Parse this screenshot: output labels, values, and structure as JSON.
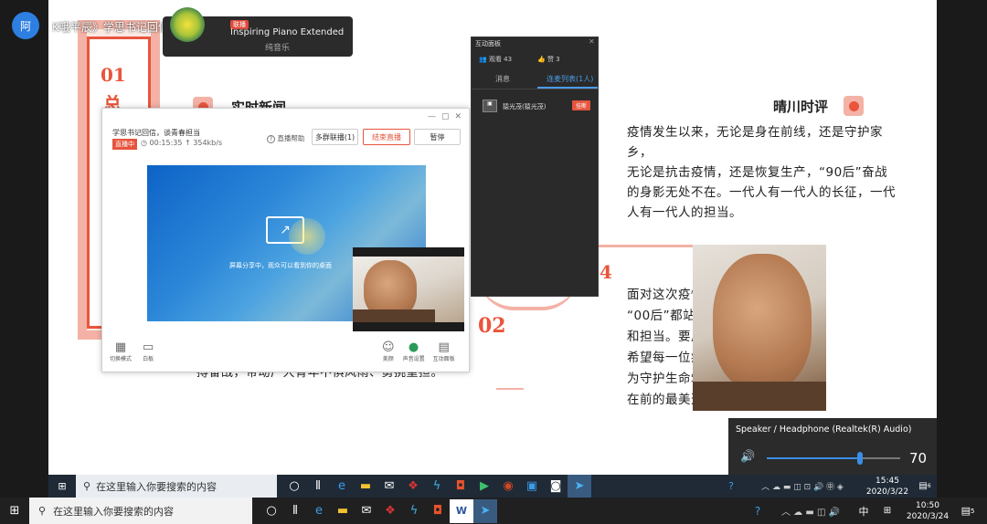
{
  "top_bar": {
    "avatar_char": "阿",
    "title": "K哦平辰》学思书记回信，谈青春担当"
  },
  "music": {
    "badge": "联播",
    "title": "Inspiring Piano Extended",
    "subtitle": "纯音乐"
  },
  "document": {
    "left_number": "01",
    "left_char": "总",
    "realtime_news": "实时新闻",
    "right_heading": "晴川时评",
    "paragraph1": [
      "疫情发生以来，无论是身在前线，还是守护家乡，",
      "无论是抗击疫情，还是恢复生产，“90后”奋战",
      "的身影无处不在。一代人有一代人的长征，一代",
      "人有一代人的担当。"
    ],
    "number4": "4",
    "number02": "02",
    "paragraph2": [
      "面对这次疫情",
      "“00后”都站",
      "和担当。要用",
      "希望每一位病",
      "为守护生命筑",
      "在前的最美逆"
    ],
    "bottom_line": "搏奋战，带动广大青年不惧风雨、勇挑重担。"
  },
  "live_window": {
    "title": "学思书记回信，谈青春担当",
    "live_badge": "直播中",
    "elapsed": "00:15:35",
    "bitrate": "354kb/s",
    "help": "直播帮助",
    "multi_mic": "多群联播(1)",
    "end_live": "结束直播",
    "pause": "暂停",
    "share_text": "屏幕分享中，观众可以看到你的桌面",
    "bottom_left": [
      {
        "icon": "grid-icon",
        "label": "切换模式"
      },
      {
        "icon": "monitor-icon",
        "label": "白板"
      }
    ],
    "bottom_right": [
      {
        "icon": "smile-icon",
        "label": "美颜"
      },
      {
        "icon": "mic-icon",
        "label": "声音设置"
      },
      {
        "icon": "chat-icon",
        "label": "互动面板"
      }
    ]
  },
  "panel": {
    "title": "互动面板",
    "viewers": "观看 43",
    "likes": "赞 3",
    "tab_messages": "消息",
    "tab_mic": "连麦列表(1人)",
    "user_name": "猿光茂(猿光茂)",
    "hangup": "挂断"
  },
  "volume": {
    "device": "Speaker / Headphone (Realtek(R) Audio)",
    "level": 70,
    "level_text": "70"
  },
  "inner_taskbar": {
    "search_placeholder": "在这里输入你要搜索的内容",
    "time": "15:45",
    "date": "2020/3/22",
    "notif": "6"
  },
  "outer_taskbar": {
    "search_placeholder": "在这里输入你要搜索的内容",
    "time": "10:50",
    "date": "2020/3/24",
    "notif": "5",
    "ime": "中"
  }
}
